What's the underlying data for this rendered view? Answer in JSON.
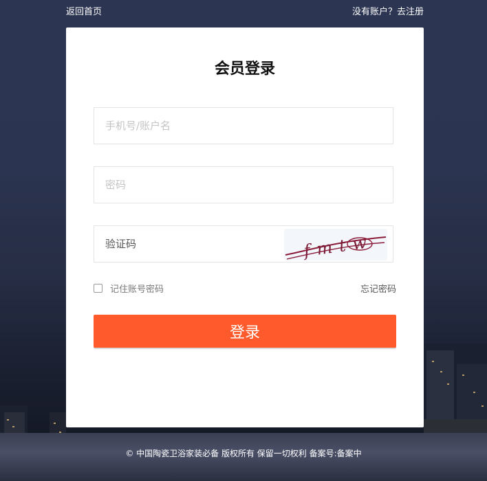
{
  "top_nav": {
    "back_home": "返回首页",
    "register": "没有账户？去注册"
  },
  "login_form": {
    "title": "会员登录",
    "account_placeholder": "手机号/账户名",
    "password_placeholder": "密码",
    "captcha_placeholder": "验证码",
    "captcha_text": "fmtw",
    "remember_label": "记住账号密码",
    "remember_checked": false,
    "forgot_link": "忘记密码",
    "submit_label": "登录"
  },
  "footer": {
    "copyright": "© 中国陶瓷卫浴家装必备 版权所有 保留一切权利 备案号:备案中"
  },
  "colors": {
    "accent": "#ff5a2c",
    "background": "#2b3450"
  }
}
